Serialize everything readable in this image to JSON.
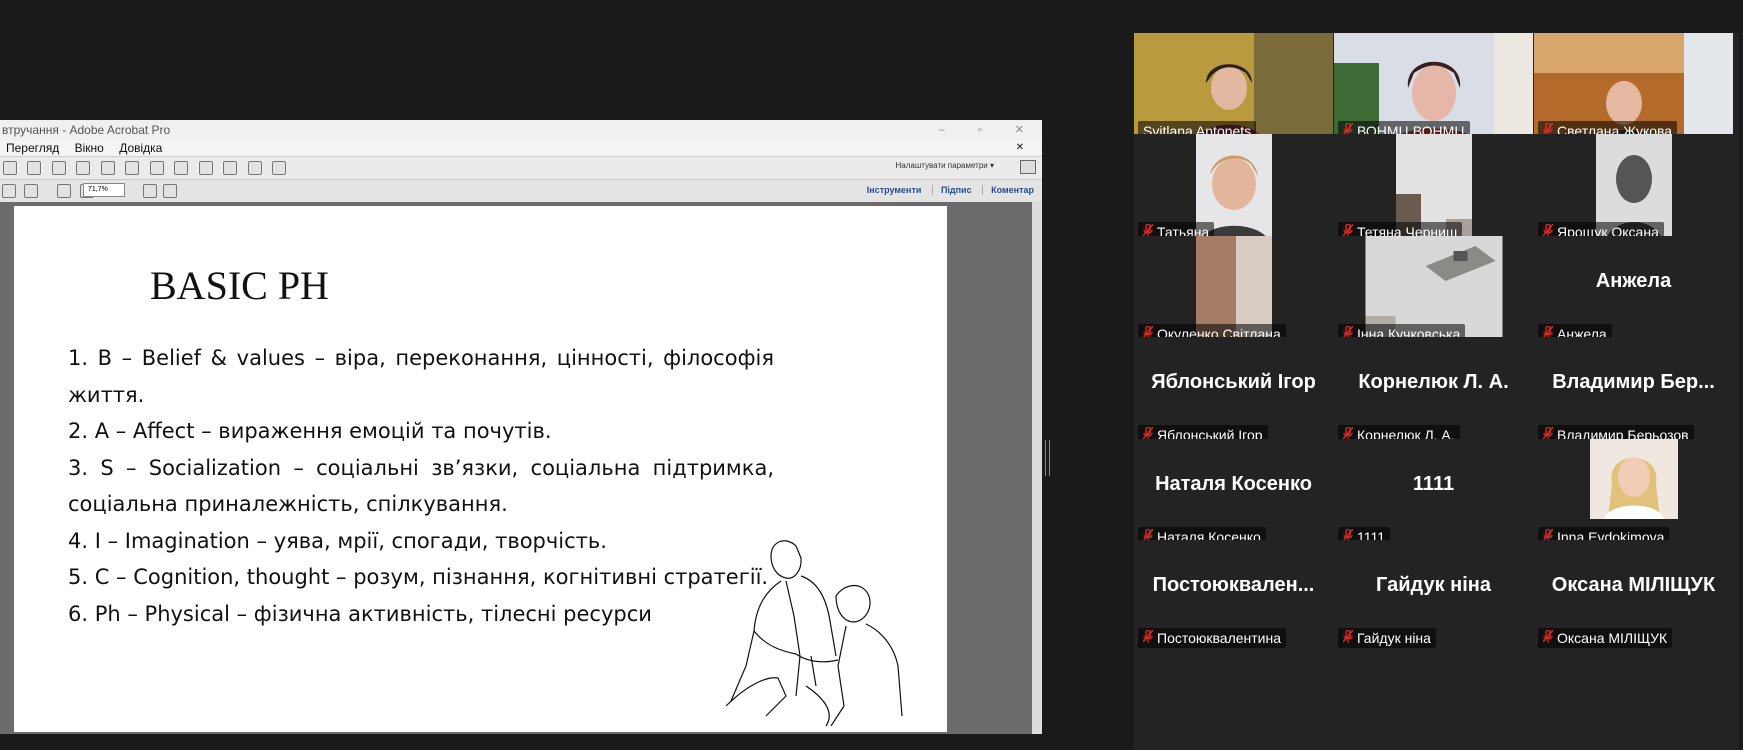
{
  "acrobat": {
    "title": "втручання - Adobe Acrobat Pro",
    "window_controls": [
      "–",
      "▫",
      "✕"
    ],
    "menu": [
      "Перегляд",
      "Вікно",
      "Довідка"
    ],
    "menu_close": "✕",
    "settings_label": "Налаштувати параметри ▾",
    "zoom": "71,7%",
    "links": {
      "tools": "Інструменти",
      "sign": "Підпис",
      "comment": "Коментар"
    }
  },
  "slide": {
    "title": "BASIC PH",
    "items": [
      "1. B – Belief & values – віра, переконання, цінності, філософія життя.",
      "2.  A – Affect – вираження емоцій та почутів.",
      "3. S – Socialization – соціальні зв’язки, соціальна підтримка, соціальна приналежність, спілкування.",
      "4.  I – Imagination – уява, мрії, спогади, творчість.",
      "5.  C – Cognition, thought – розум, пізнання, когнітивні стратегії.",
      "6.  Ph – Physical – фізична активність, тілесні ресурси"
    ]
  },
  "participants": [
    {
      "name": "Svitlana Antonets",
      "big": "",
      "muted": false,
      "video": "svitlana",
      "active": true
    },
    {
      "name": "ВОНМЦ ВОНМЦ",
      "big": "",
      "muted": true,
      "video": "vonmc",
      "active": false
    },
    {
      "name": "Светлана Жукова",
      "big": "",
      "muted": true,
      "video": "zhukova",
      "active": false
    },
    {
      "name": "Татьяна",
      "big": "",
      "muted": true,
      "video": "tatiana",
      "active": false
    },
    {
      "name": "Тетяна Черниш",
      "big": "",
      "muted": true,
      "video": "chernysh",
      "active": false
    },
    {
      "name": "Ярощук Оксана",
      "big": "",
      "muted": true,
      "video": "yaroshchuk",
      "active": false
    },
    {
      "name": "Окуленко Світлана",
      "big": "",
      "muted": true,
      "video": "okulenko",
      "active": false
    },
    {
      "name": "Інна Кучковська",
      "big": "",
      "muted": true,
      "video": "kuchkovska",
      "active": false
    },
    {
      "name": "Анжела",
      "big": "Анжела",
      "muted": true,
      "video": "",
      "active": false
    },
    {
      "name": "Яблонський Ігор",
      "big": "Яблонський Ігор",
      "muted": true,
      "video": "",
      "active": false
    },
    {
      "name": "Корнелюк Л. А.",
      "big": "Корнелюк Л. А.",
      "muted": true,
      "video": "",
      "active": false
    },
    {
      "name": "Владимир Берьозов",
      "big": "Владимир Бер...",
      "muted": true,
      "video": "",
      "active": false
    },
    {
      "name": "Наталя Косенко",
      "big": "Наталя Косенко",
      "muted": true,
      "video": "",
      "active": false
    },
    {
      "name": "1111",
      "big": "1111",
      "muted": true,
      "video": "",
      "active": false
    },
    {
      "name": "Inna Evdokimova",
      "big": "",
      "muted": true,
      "video": "evdokimova",
      "active": false
    },
    {
      "name": "Постоюквалентина",
      "big": "Постоюквален...",
      "muted": true,
      "video": "",
      "active": false
    },
    {
      "name": "Гайдук ніна",
      "big": "Гайдук ніна",
      "muted": true,
      "video": "",
      "active": false
    },
    {
      "name": "Оксана МІЛІЩУК",
      "big": "Оксана МІЛІЩУК",
      "muted": true,
      "video": "",
      "active": false
    }
  ],
  "colors": {
    "active_border": "#2ecc71",
    "mic_muted": "#e02828",
    "panel_bg": "#232323"
  }
}
